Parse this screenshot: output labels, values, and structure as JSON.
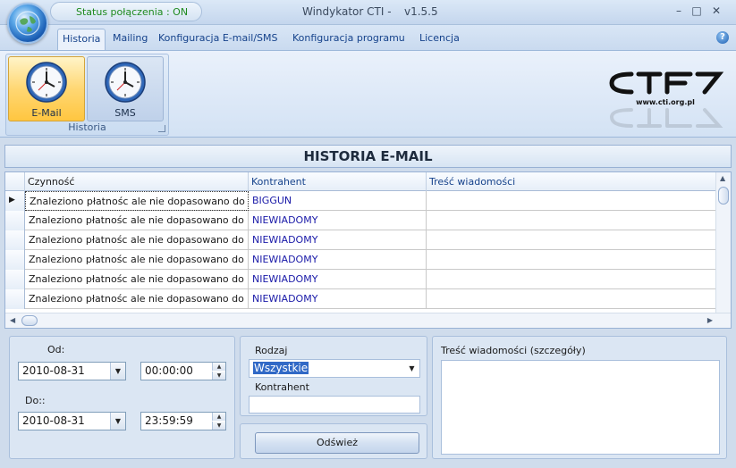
{
  "titlebar": {
    "status": "Status połączenia : ON",
    "title": "Windykator CTI  -",
    "version": "v1.5.5",
    "minimize": "–",
    "maximize": "□",
    "close": "✕"
  },
  "tabs": [
    "Historia",
    "Mailing",
    "Konfiguracja E-mail/SMS",
    "Konfiguracja programu",
    "Licencja"
  ],
  "help": "?",
  "ribbon": {
    "group_label": "Historia",
    "email_label": "E-Mail",
    "sms_label": "SMS",
    "logo_text": "www.cti.org.pl"
  },
  "section": {
    "title": "HISTORIA E-MAIL"
  },
  "grid": {
    "columns": [
      "Czynność",
      "Kontrahent",
      "Treść wiadomości"
    ],
    "rows": [
      {
        "action": "Znaleziono płatnośc ale nie dopasowano do niej",
        "contractor": "BIGGUN",
        "message": ""
      },
      {
        "action": "Znaleziono płatnośc ale nie dopasowano do niej",
        "contractor": "NIEWIADOMY",
        "message": ""
      },
      {
        "action": "Znaleziono płatnośc ale nie dopasowano do niej",
        "contractor": "NIEWIADOMY",
        "message": ""
      },
      {
        "action": "Znaleziono płatnośc ale nie dopasowano do niej",
        "contractor": "NIEWIADOMY",
        "message": ""
      },
      {
        "action": "Znaleziono płatnośc ale nie dopasowano do niej",
        "contractor": "NIEWIADOMY",
        "message": ""
      },
      {
        "action": "Znaleziono płatnośc ale nie dopasowano do niej",
        "contractor": "NIEWIADOMY",
        "message": ""
      }
    ]
  },
  "filters": {
    "from_label": "Od:",
    "from_date": "2010-08-31",
    "from_time": "00:00:00",
    "to_label": "Do::",
    "to_date": "2010-08-31",
    "to_time": "23:59:59",
    "type_label": "Rodzaj",
    "type_value": "Wszystkie",
    "contractor_label": "Kontrahent",
    "contractor_value": "",
    "refresh_label": "Odśwież",
    "details_label": "Treść wiadomości (szczegóły)"
  },
  "colors": {
    "status_on": "#1e8a1e",
    "accent": "#15428b",
    "selected_button": "#ffd773"
  }
}
